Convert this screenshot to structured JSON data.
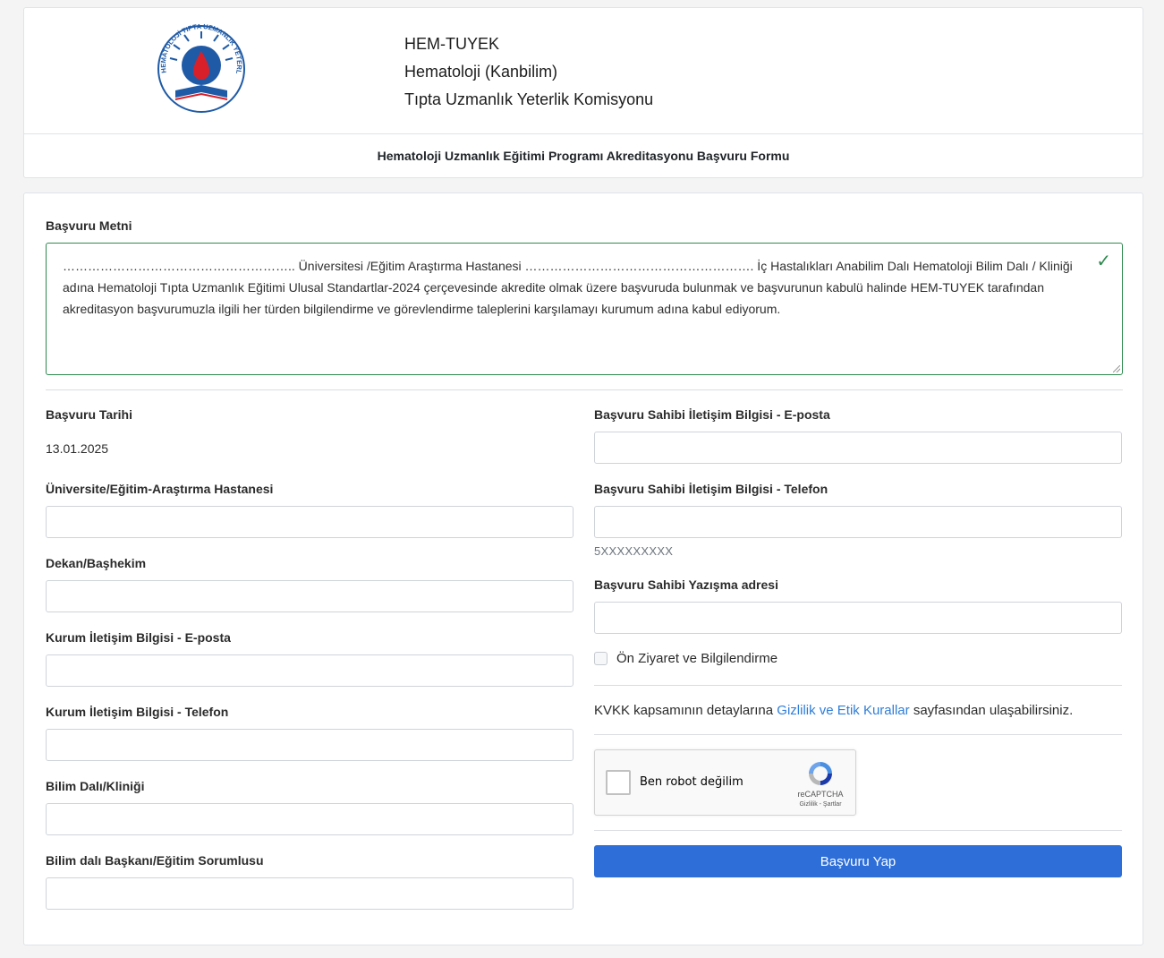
{
  "header": {
    "org_short": "HEM-TUYEK",
    "org_line2": "Hematoloji (Kanbilim)",
    "org_line3": "Tıpta Uzmanlık Yeterlik Komisyonu",
    "form_title": "Hematoloji Uzmanlık Eğitimi Programı Akreditasyonu Başvuru Formu",
    "logo_ring_text": "HEMATOLOJİ TIPTA UZMANLIK YETERLİK KOMİSYONU"
  },
  "application_text": {
    "label": "Başvuru Metni",
    "value": "……………………………………………….. Üniversitesi /Eğitim  Araştırma Hastanesi ……………………………………………….  İç Hastalıkları Anabilim Dalı Hematoloji Bilim Dalı / Kliniği adına Hematoloji Tıpta Uzmanlık Eğitimi Ulusal Standartlar-2024 çerçevesinde akredite olmak üzere başvuruda bulunmak ve başvurunun kabulü halinde HEM-TUYEK tarafından akreditasyon başvurumuzla ilgili her türden bilgilendirme ve görevlendirme taleplerini karşılamayı kurumum adına kabul ediyorum.",
    "valid_icon": "check-icon"
  },
  "left_fields": {
    "date_label": "Başvuru Tarihi",
    "date_value": "13.01.2025",
    "university_label": "Üniversite/Eğitim-Araştırma Hastanesi",
    "dean_label": "Dekan/Başhekim",
    "inst_email_label": "Kurum İletişim Bilgisi - E-posta",
    "inst_phone_label": "Kurum İletişim Bilgisi - Telefon",
    "department_label": "Bilim Dalı/Kliniği",
    "head_label": "Bilim dalı Başkanı/Eğitim Sorumlusu"
  },
  "right_fields": {
    "applicant_email_label": "Başvuru Sahibi İletişim Bilgisi - E-posta",
    "applicant_phone_label": "Başvuru Sahibi İletişim Bilgisi - Telefon",
    "phone_hint": "5XXXXXXXXX",
    "address_label": "Başvuru Sahibi Yazışma adresi",
    "pre_visit_label": "Ön Ziyaret ve Bilgilendirme",
    "pre_visit_checked": false,
    "kvkk_before": "KVKK kapsamının detaylarına ",
    "kvkk_link": "Gizlilik ve Etik Kurallar",
    "kvkk_after": " sayfasından ulaşabilirsiniz."
  },
  "recaptcha": {
    "label": "Ben robot değilim",
    "brand": "reCAPTCHA",
    "links": "Gizlilik - Şartlar"
  },
  "submit": {
    "label": "Başvuru Yap",
    "color": "#2d6ed8"
  },
  "colors": {
    "valid_border": "#2e8a4f",
    "link": "#2f7ed8",
    "logo_blue": "#1f5aa6",
    "logo_red": "#d8202a"
  }
}
